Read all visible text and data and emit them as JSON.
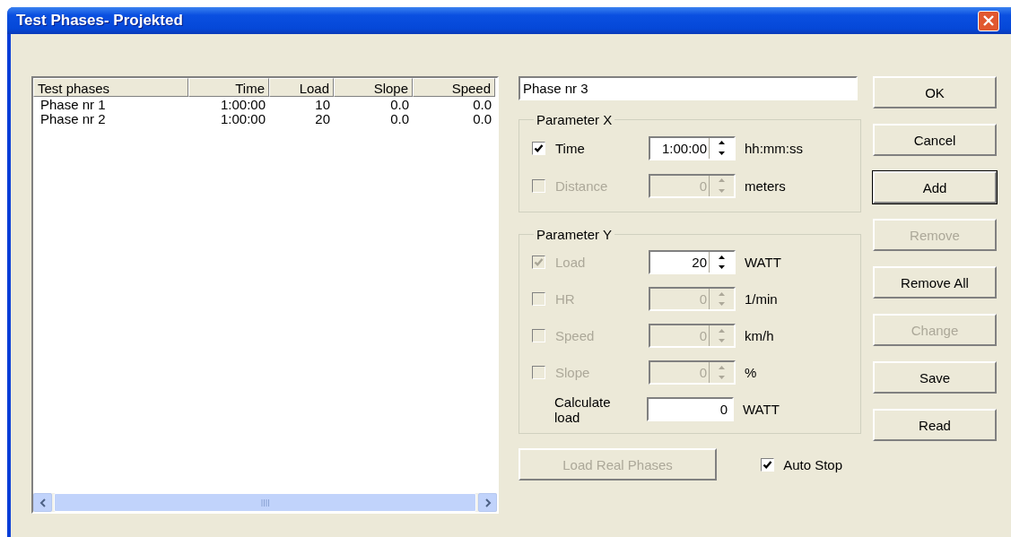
{
  "window": {
    "title": "Test Phases- Projekted"
  },
  "table": {
    "columns": [
      "Test phases",
      "Time",
      "Load",
      "Slope",
      "Speed"
    ],
    "rows": [
      [
        "Phase nr 1",
        "1:00:00",
        "10",
        "0.0",
        "0.0"
      ],
      [
        "Phase nr 2",
        "1:00:00",
        "20",
        "0.0",
        "0.0"
      ]
    ]
  },
  "name_field": {
    "value": "Phase nr 3"
  },
  "parameter_x": {
    "title": "Parameter X",
    "rows": [
      {
        "kind": "spin",
        "label": "Time",
        "checked": true,
        "disabled": false,
        "value": "1:00:00",
        "field_disabled": false,
        "unit": "hh:mm:ss"
      },
      {
        "kind": "spin",
        "label": "Distance",
        "checked": false,
        "disabled": true,
        "value": "0",
        "field_disabled": true,
        "unit": "meters"
      }
    ]
  },
  "parameter_y": {
    "title": "Parameter Y",
    "rows": [
      {
        "kind": "spin",
        "label": "Load",
        "checked": true,
        "disabled": true,
        "value": "20",
        "field_disabled": false,
        "unit": "WATT"
      },
      {
        "kind": "spin",
        "label": "HR",
        "checked": false,
        "disabled": true,
        "value": "0",
        "field_disabled": true,
        "unit": "1/min"
      },
      {
        "kind": "spin",
        "label": "Speed",
        "checked": false,
        "disabled": true,
        "value": "0",
        "field_disabled": true,
        "unit": "km/h"
      },
      {
        "kind": "spin",
        "label": "Slope",
        "checked": false,
        "disabled": true,
        "value": "0",
        "field_disabled": true,
        "unit": "%"
      },
      {
        "kind": "calc",
        "label": "Calculate load",
        "value": "0",
        "field_disabled": false,
        "unit": "WATT"
      }
    ]
  },
  "buttons": [
    {
      "label": "OK",
      "disabled": false,
      "default": false
    },
    {
      "label": "Cancel",
      "disabled": false,
      "default": false
    },
    {
      "label": "Add",
      "disabled": false,
      "default": true
    },
    {
      "label": "Remove",
      "disabled": true,
      "default": false
    },
    {
      "label": "Remove All",
      "disabled": false,
      "default": false
    },
    {
      "label": "Change",
      "disabled": true,
      "default": false
    },
    {
      "label": "Save",
      "disabled": false,
      "default": false
    },
    {
      "label": "Read",
      "disabled": false,
      "default": false
    }
  ],
  "load_real_phases": {
    "label": "Load Real Phases",
    "disabled": true
  },
  "auto_stop": {
    "label": "Auto Stop",
    "checked": true
  }
}
